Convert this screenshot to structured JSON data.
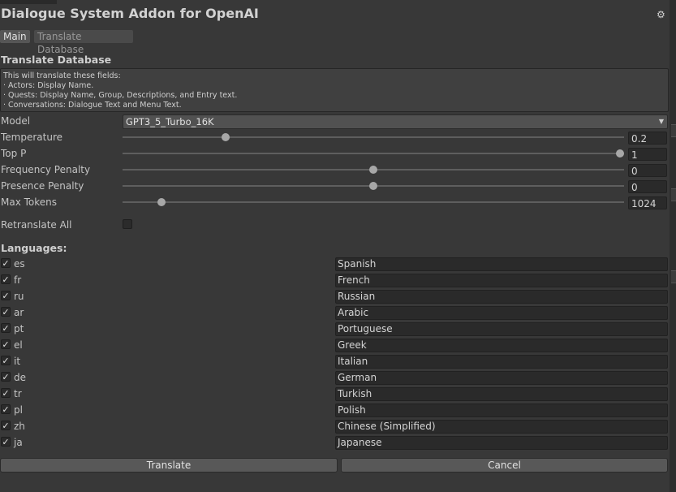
{
  "window": {
    "title": "Dialogue System Addon for OpenAI"
  },
  "tabs": [
    {
      "label": "Main",
      "active": true
    },
    {
      "label": "Translate Database",
      "active": false
    }
  ],
  "section": {
    "title": "Translate Database",
    "help": [
      "This will translate these fields:",
      "· Actors: Display Name.",
      "· Quests: Display Name, Group, Descriptions, and Entry text.",
      "· Conversations: Dialogue Text and Menu Text."
    ]
  },
  "model": {
    "label": "Model",
    "value": "GPT3_5_Turbo_16K"
  },
  "sliders": [
    {
      "label": "Temperature",
      "value": "0.2",
      "fraction": 0.2
    },
    {
      "label": "Top P",
      "value": "1",
      "fraction": 1.0
    },
    {
      "label": "Frequency Penalty",
      "value": "0",
      "fraction": 0.5
    },
    {
      "label": "Presence Penalty",
      "value": "0",
      "fraction": 0.5
    },
    {
      "label": "Max Tokens",
      "value": "1024",
      "fraction": 0.07
    }
  ],
  "retranslate": {
    "label": "Retranslate All",
    "checked": false
  },
  "languages_title": "Languages:",
  "languages": [
    {
      "code": "es",
      "name": "Spanish",
      "checked": true
    },
    {
      "code": "fr",
      "name": "French",
      "checked": true
    },
    {
      "code": "ru",
      "name": "Russian",
      "checked": true
    },
    {
      "code": "ar",
      "name": "Arabic",
      "checked": true
    },
    {
      "code": "pt",
      "name": "Portuguese",
      "checked": true
    },
    {
      "code": "el",
      "name": "Greek",
      "checked": true
    },
    {
      "code": "it",
      "name": "Italian",
      "checked": true
    },
    {
      "code": "de",
      "name": "German",
      "checked": true
    },
    {
      "code": "tr",
      "name": "Turkish",
      "checked": true
    },
    {
      "code": "pl",
      "name": "Polish",
      "checked": true
    },
    {
      "code": "zh",
      "name": "Chinese (Simplified)",
      "checked": true
    },
    {
      "code": "ja",
      "name": "Japanese",
      "checked": true
    }
  ],
  "buttons": {
    "translate": "Translate",
    "cancel": "Cancel"
  },
  "colors": {
    "background": "#383838",
    "field": "#2a2a2a",
    "button": "#585858"
  }
}
